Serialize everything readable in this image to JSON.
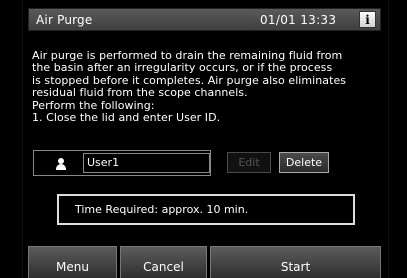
{
  "header": {
    "title": "Air Purge",
    "datetime": "01/01 13:33",
    "info_label": "i"
  },
  "description": {
    "lines": [
      "Air purge is performed to drain the remaining fluid from",
      "the basin after an irregularity occurs, or if the process",
      "is stopped before it completes. Air purge also eliminates",
      "residual fluid from the scope channels.",
      "Perform the following:",
      "1. Close the lid and enter User ID."
    ]
  },
  "user": {
    "icon": "person-icon",
    "value": "User1",
    "edit_label": "Edit",
    "delete_label": "Delete"
  },
  "time_required": "Time Required: approx. 10 min.",
  "footer": {
    "menu_label": "Menu",
    "cancel_label": "Cancel",
    "start_label": "Start"
  },
  "colors": {
    "background": "#000000",
    "titlebar": "#4a4a4a",
    "text": "#ffffff",
    "disabled_text": "#555555"
  }
}
